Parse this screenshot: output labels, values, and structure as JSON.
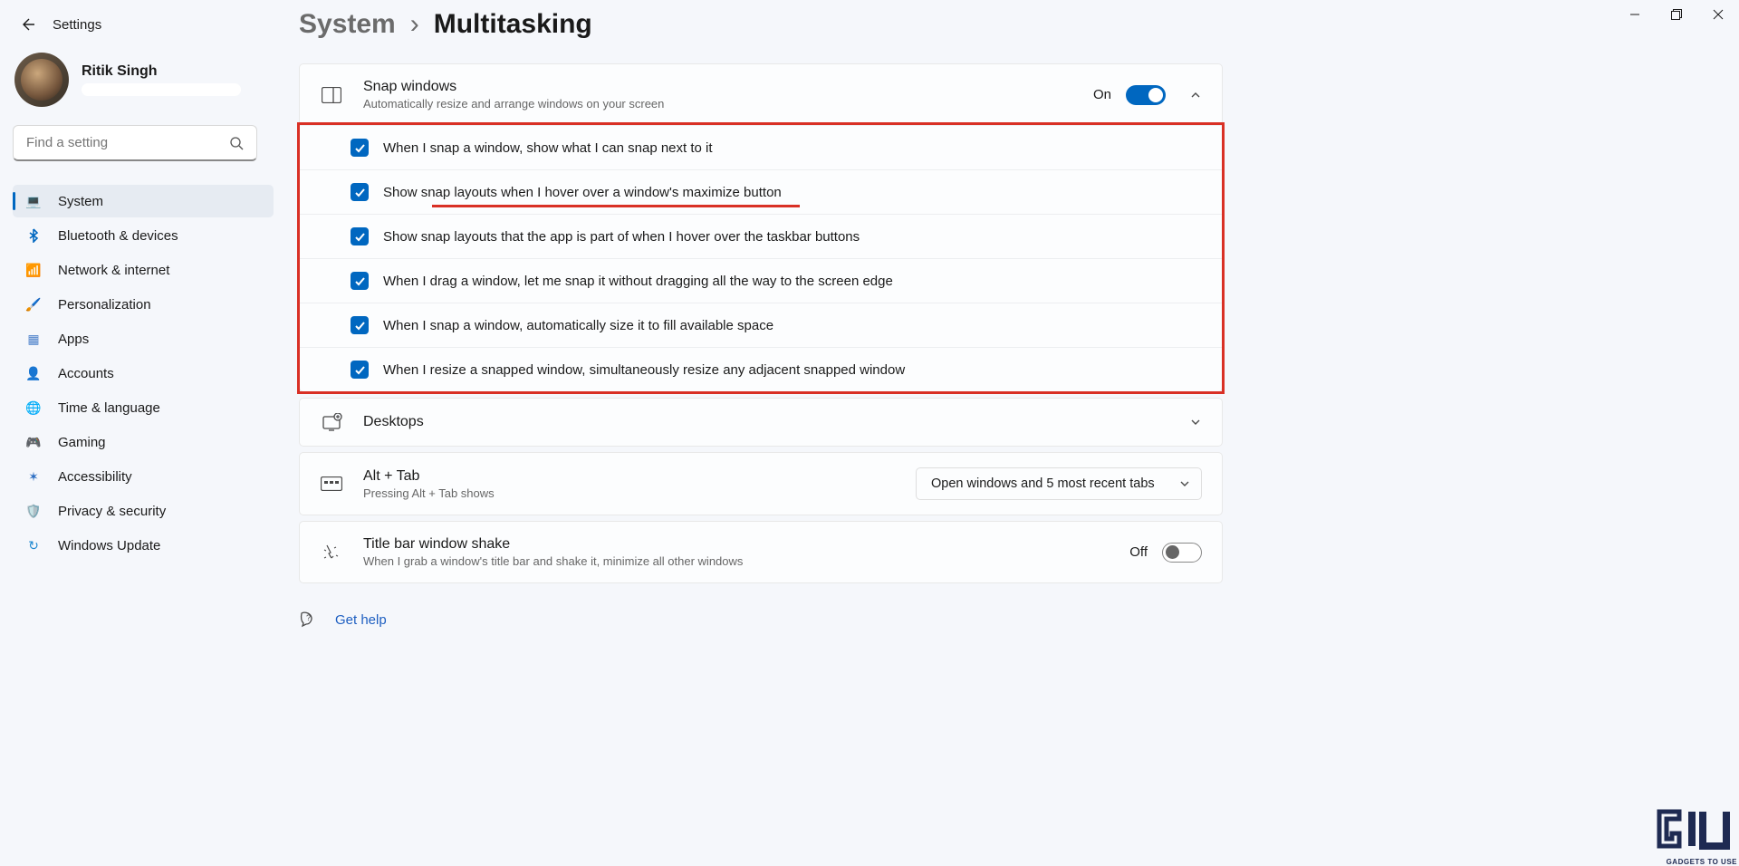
{
  "app": {
    "title": "Settings"
  },
  "user": {
    "name": "Ritik Singh"
  },
  "search": {
    "placeholder": "Find a setting"
  },
  "nav": [
    {
      "icon": "💻",
      "label": "System",
      "active": true,
      "iconColor": "#0067c0"
    },
    {
      "icon": "B",
      "label": "Bluetooth & devices",
      "iconStyle": "bt"
    },
    {
      "icon": "📶",
      "label": "Network & internet",
      "iconColor": "#0aa2d4"
    },
    {
      "icon": "🖌️",
      "label": "Personalization"
    },
    {
      "icon": "▦",
      "label": "Apps",
      "iconColor": "#4a7fc9"
    },
    {
      "icon": "👤",
      "label": "Accounts",
      "iconColor": "#4fb24f"
    },
    {
      "icon": "🌐",
      "label": "Time & language",
      "iconColor": "#5b9bd5"
    },
    {
      "icon": "🎮",
      "label": "Gaming",
      "iconColor": "#888"
    },
    {
      "icon": "✶",
      "label": "Accessibility",
      "iconColor": "#2a6cc2"
    },
    {
      "icon": "🛡️",
      "label": "Privacy & security",
      "iconColor": "#9a9a9a"
    },
    {
      "icon": "↻",
      "label": "Windows Update",
      "iconColor": "#1e88d0"
    }
  ],
  "breadcrumb": {
    "parent": "System",
    "sep": "›",
    "current": "Multitasking"
  },
  "snap": {
    "title": "Snap windows",
    "sub": "Automatically resize and arrange windows on your screen",
    "state": "On",
    "options": [
      "When I snap a window, show what I can snap next to it",
      "Show snap layouts when I hover over a window's maximize button",
      "Show snap layouts that the app is part of when I hover over the taskbar buttons",
      "When I drag a window, let me snap it without dragging all the way to the screen edge",
      "When I snap a window, automatically size it to fill available space",
      "When I resize a snapped window, simultaneously resize any adjacent snapped window"
    ]
  },
  "desktops": {
    "title": "Desktops"
  },
  "alttab": {
    "title": "Alt + Tab",
    "sub": "Pressing Alt + Tab shows",
    "value": "Open windows and 5 most recent tabs"
  },
  "shake": {
    "title": "Title bar window shake",
    "sub": "When I grab a window's title bar and shake it, minimize all other windows",
    "state": "Off"
  },
  "help": {
    "label": "Get help"
  },
  "watermark": "GADGETS TO USE"
}
